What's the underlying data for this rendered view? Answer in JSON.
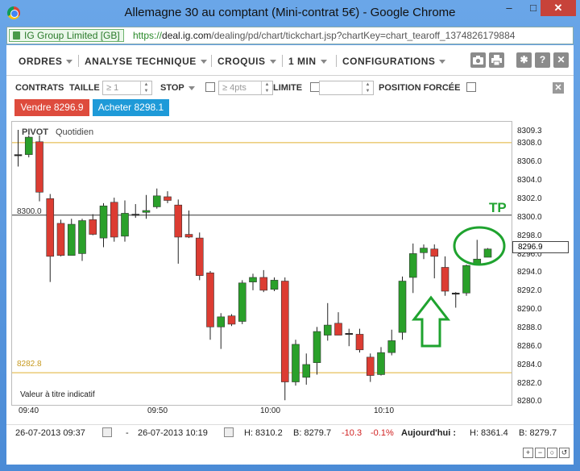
{
  "window": {
    "title": "Allemagne 30 au comptant (Mini-contrat 5€) - Google Chrome",
    "minimize_symbol": "–",
    "maximize_symbol": "□",
    "close_symbol": "✕"
  },
  "address_bar": {
    "certificate": "IG Group Limited [GB]",
    "scheme": "https://",
    "domain": "deal.ig.com",
    "path": "/dealing/pd/chart/tickchart.jsp?chartKey=chart_tearoff_1374826179884"
  },
  "menu": {
    "ordres": "ORDRES",
    "analyse": "ANALYSE TECHNIQUE",
    "croquis": "CROQUIS",
    "interval": "1 MIN",
    "config": "CONFIGURATIONS",
    "icons": [
      "camera-icon",
      "print-icon",
      "gear-icon",
      "help-icon",
      "close-icon"
    ],
    "icon_glyphs": {
      "settings": "✱",
      "help": "?",
      "close": "✕"
    }
  },
  "order_bar": {
    "contrats": "CONTRATS",
    "taille": "TAILLE",
    "taille_placeholder": "≥ 1",
    "stop": "STOP",
    "stop_placeholder": "≥ 4pts",
    "limite": "LIMITE",
    "position_forcee": "POSITION FORCÉE",
    "close_glyph": "✕"
  },
  "trade_buttons": {
    "sell": "Vendre 8296.9",
    "buy": "Acheter 8298.1",
    "sell_color": "#de4b3d",
    "buy_color": "#1e9ad8"
  },
  "chart_labels": {
    "pivot": "PIVOT",
    "period": "Quotidien",
    "indicative": "Valeur à titre indicatif",
    "pivot_value": "8300.0",
    "support_value": "8282.8",
    "annotation": "TP",
    "current_price": "8296.9"
  },
  "chart_data": {
    "type": "candlestick",
    "instrument": "Allemagne 30 au comptant (Mini-contrat 5€)",
    "interval": "1 MIN",
    "y_ticks": [
      "8309.3",
      "8308.0",
      "8306.0",
      "8304.0",
      "8302.0",
      "8300.0",
      "8298.0",
      "8296.0",
      "8294.0",
      "8292.0",
      "8290.0",
      "8288.0",
      "8286.0",
      "8284.0",
      "8282.0",
      "8280.0"
    ],
    "x_ticks": [
      "09:40",
      "09:50",
      "10:00",
      "10:10"
    ],
    "ylim": [
      8279.7,
      8310.2
    ],
    "reference_lines": [
      {
        "label": "8300.0",
        "value": 8300.0,
        "color": "#333333"
      },
      {
        "value": 8307.9,
        "color": "#e0b030"
      },
      {
        "label": "8282.8",
        "value": 8282.8,
        "color": "#e0b030"
      }
    ],
    "colors": {
      "up": "#2aa02a",
      "down": "#dc3c32"
    },
    "candles": [
      {
        "o": 8306.6,
        "h": 8309.3,
        "l": 8305.3,
        "c": 8306.6
      },
      {
        "o": 8306.6,
        "h": 8308.7,
        "l": 8306.3,
        "c": 8308.5
      },
      {
        "o": 8308.0,
        "h": 8308.7,
        "l": 8301.5,
        "c": 8302.5
      },
      {
        "o": 8301.8,
        "h": 8302.3,
        "l": 8292.7,
        "c": 8295.5
      },
      {
        "o": 8299.1,
        "h": 8299.5,
        "l": 8295.5,
        "c": 8295.6
      },
      {
        "o": 8295.6,
        "h": 8299.6,
        "l": 8295.6,
        "c": 8299.0
      },
      {
        "o": 8295.8,
        "h": 8299.6,
        "l": 8295.0,
        "c": 8299.4
      },
      {
        "o": 8299.5,
        "h": 8300.1,
        "l": 8297.8,
        "c": 8297.9
      },
      {
        "o": 8297.5,
        "h": 8301.3,
        "l": 8296.5,
        "c": 8301.0
      },
      {
        "o": 8301.4,
        "h": 8301.9,
        "l": 8297.1,
        "c": 8297.6
      },
      {
        "o": 8297.7,
        "h": 8301.6,
        "l": 8297.1,
        "c": 8300.2
      },
      {
        "o": 8300.1,
        "h": 8301.2,
        "l": 8299.7,
        "c": 8300.0
      },
      {
        "o": 8300.3,
        "h": 8302.2,
        "l": 8299.6,
        "c": 8300.5
      },
      {
        "o": 8300.9,
        "h": 8302.9,
        "l": 8300.7,
        "c": 8302.1
      },
      {
        "o": 8302.0,
        "h": 8302.6,
        "l": 8301.3,
        "c": 8301.6
      },
      {
        "o": 8301.1,
        "h": 8301.7,
        "l": 8294.7,
        "c": 8297.6
      },
      {
        "o": 8297.9,
        "h": 8300.5,
        "l": 8297.5,
        "c": 8297.6
      },
      {
        "o": 8297.5,
        "h": 8298.1,
        "l": 8292.9,
        "c": 8293.4
      },
      {
        "o": 8293.7,
        "h": 8293.9,
        "l": 8286.4,
        "c": 8287.8
      },
      {
        "o": 8287.8,
        "h": 8289.3,
        "l": 8285.4,
        "c": 8288.9
      },
      {
        "o": 8289.0,
        "h": 8289.2,
        "l": 8287.9,
        "c": 8288.1
      },
      {
        "o": 8288.4,
        "h": 8292.9,
        "l": 8288.1,
        "c": 8292.6
      },
      {
        "o": 8292.7,
        "h": 8293.6,
        "l": 8291.8,
        "c": 8293.2
      },
      {
        "o": 8293.2,
        "h": 8294.0,
        "l": 8291.6,
        "c": 8291.8
      },
      {
        "o": 8291.9,
        "h": 8293.2,
        "l": 8291.7,
        "c": 8292.9
      },
      {
        "o": 8292.8,
        "h": 8293.2,
        "l": 8279.8,
        "c": 8281.8
      },
      {
        "o": 8281.8,
        "h": 8286.4,
        "l": 8281.4,
        "c": 8285.9
      },
      {
        "o": 8282.3,
        "h": 8284.9,
        "l": 8281.5,
        "c": 8283.7
      },
      {
        "o": 8283.9,
        "h": 8287.8,
        "l": 8282.6,
        "c": 8287.3
      },
      {
        "o": 8286.9,
        "h": 8290.4,
        "l": 8286.3,
        "c": 8288.0
      },
      {
        "o": 8288.2,
        "h": 8289.4,
        "l": 8287.3,
        "c": 8286.9
      },
      {
        "o": 8287.1,
        "h": 8287.6,
        "l": 8285.7,
        "c": 8287.1
      },
      {
        "o": 8287.0,
        "h": 8287.6,
        "l": 8285.0,
        "c": 8285.3
      },
      {
        "o": 8284.5,
        "h": 8284.9,
        "l": 8281.8,
        "c": 8282.5
      },
      {
        "o": 8282.6,
        "h": 8285.6,
        "l": 8282.5,
        "c": 8285.0
      },
      {
        "o": 8285.0,
        "h": 8287.5,
        "l": 8284.7,
        "c": 8286.3
      },
      {
        "o": 8287.2,
        "h": 8293.3,
        "l": 8286.4,
        "c": 8292.8
      },
      {
        "o": 8293.2,
        "h": 8296.9,
        "l": 8291.5,
        "c": 8295.8
      },
      {
        "o": 8295.9,
        "h": 8296.8,
        "l": 8295.2,
        "c": 8296.4
      },
      {
        "o": 8296.3,
        "h": 8296.8,
        "l": 8293.1,
        "c": 8295.5
      },
      {
        "o": 8294.3,
        "h": 8295.5,
        "l": 8291.2,
        "c": 8291.7
      },
      {
        "o": 8291.5,
        "h": 8291.6,
        "l": 8289.9,
        "c": 8291.4
      },
      {
        "o": 8291.5,
        "h": 8294.6,
        "l": 8291.2,
        "c": 8294.5
      },
      {
        "o": 8294.6,
        "h": 8297.3,
        "l": 8294.6,
        "c": 8295.2
      },
      {
        "o": 8295.4,
        "h": 8296.4,
        "l": 8295.4,
        "c": 8296.3
      }
    ]
  },
  "footer": {
    "start": "26-07-2013 09:37",
    "dash": "-",
    "end": "26-07-2013 10:19",
    "high": "H: 8310.2",
    "low": "B: 8279.7",
    "change": "-10.3",
    "change_pct": "-0.1%",
    "today_label": "Aujourd'hui :",
    "today_high": "H: 8361.4",
    "today_low": "B: 8279.7",
    "change_color": "#d02020"
  },
  "controls": [
    "+",
    "−",
    "○",
    "↺"
  ]
}
